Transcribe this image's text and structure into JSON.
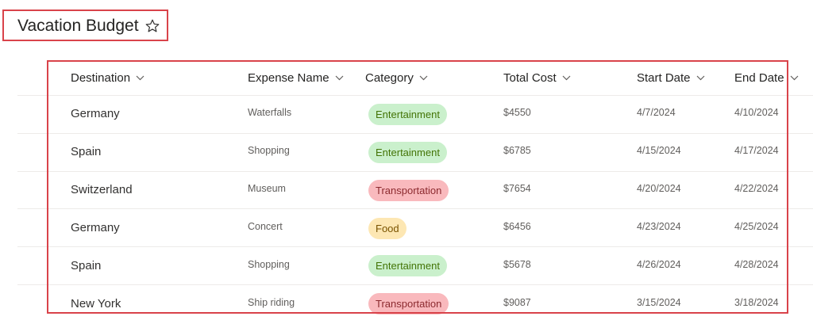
{
  "title": "Vacation Budget",
  "colors": {
    "highlight": "#d9434a",
    "entertainment_bg": "#caf0cc",
    "entertainment_fg": "#437406",
    "transportation_bg": "#f9b9bd",
    "transportation_fg": "#8c2a2f",
    "food_bg": "#fde7b3",
    "food_fg": "#7a5300"
  },
  "columns": {
    "destination": "Destination",
    "expense_name": "Expense Name",
    "category": "Category",
    "total_cost": "Total Cost",
    "start_date": "Start Date",
    "end_date": "End Date"
  },
  "rows": [
    {
      "destination": "Germany",
      "expense_name": "Waterfalls",
      "category": "Entertainment",
      "total_cost": "$4550",
      "start_date": "4/7/2024",
      "end_date": "4/10/2024"
    },
    {
      "destination": "Spain",
      "expense_name": "Shopping",
      "category": "Entertainment",
      "total_cost": "$6785",
      "start_date": "4/15/2024",
      "end_date": "4/17/2024"
    },
    {
      "destination": "Switzerland",
      "expense_name": "Museum",
      "category": "Transportation",
      "total_cost": "$7654",
      "start_date": "4/20/2024",
      "end_date": "4/22/2024"
    },
    {
      "destination": "Germany",
      "expense_name": "Concert",
      "category": "Food",
      "total_cost": "$6456",
      "start_date": "4/23/2024",
      "end_date": "4/25/2024"
    },
    {
      "destination": "Spain",
      "expense_name": "Shopping",
      "category": "Entertainment",
      "total_cost": "$5678",
      "start_date": "4/26/2024",
      "end_date": "4/28/2024"
    },
    {
      "destination": "New York",
      "expense_name": "Ship riding",
      "category": "Transportation",
      "total_cost": "$9087",
      "start_date": "3/15/2024",
      "end_date": "3/18/2024"
    }
  ]
}
